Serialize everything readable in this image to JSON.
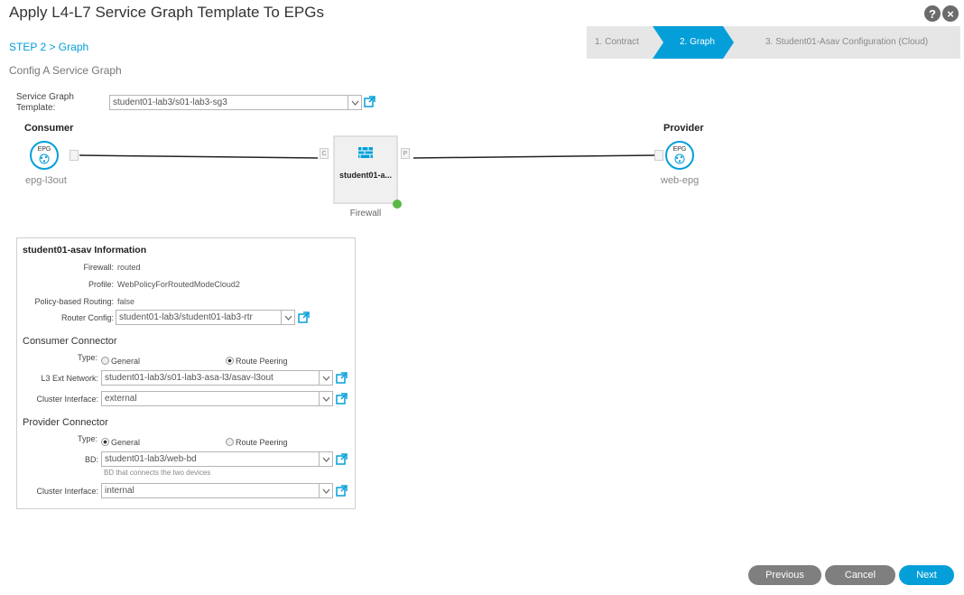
{
  "window": {
    "title": "Apply L4-L7 Service Graph Template To EPGs",
    "help_icon": "?",
    "close_icon": "×"
  },
  "step": {
    "label": "STEP 2 > Graph",
    "subtitle": "Config A Service Graph"
  },
  "wizard": {
    "steps": [
      {
        "label": "1. Contract",
        "active": false
      },
      {
        "label": "2. Graph",
        "active": true
      },
      {
        "label": "3. Student01-Asav Configuration (Cloud)",
        "active": false
      }
    ],
    "active_color": "#049fd9"
  },
  "template": {
    "label": "Service Graph Template:",
    "value": "student01-lab3/s01-lab3-sg3"
  },
  "graph": {
    "consumer": {
      "role": "Consumer",
      "badge": "EPG",
      "name": "epg-l3out"
    },
    "provider": {
      "role": "Provider",
      "badge": "EPG",
      "name": "web-epg"
    },
    "device": {
      "name": "student01-a...",
      "type": "Firewall",
      "status_color": "#5ab847"
    },
    "connectors": {
      "consumer": "C",
      "provider": "P"
    }
  },
  "info": {
    "title": "student01-asav Information",
    "firewall_label": "Firewall:",
    "firewall_value": "routed",
    "profile_label": "Profile:",
    "profile_value": "WebPolicyForRoutedModeCloud2",
    "pbr_label": "Policy-based Routing:",
    "pbr_value": "false",
    "router_label": "Router Config:",
    "router_value": "student01-lab3/student01-lab3-rtr",
    "consumer": {
      "heading": "Consumer Connector",
      "type_label": "Type:",
      "opt_general": "General",
      "opt_route": "Route Peering",
      "selected": "route",
      "l3_label": "L3 Ext Network:",
      "l3_value": "student01-lab3/s01-lab3-asa-l3/asav-l3out",
      "cluster_label": "Cluster Interface:",
      "cluster_value": "external"
    },
    "provider": {
      "heading": "Provider Connector",
      "type_label": "Type:",
      "opt_general": "General",
      "opt_route": "Route Peering",
      "selected": "general",
      "bd_label": "BD:",
      "bd_value": "student01-lab3/web-bd",
      "bd_hint": "BD that connects the two devices",
      "cluster_label": "Cluster Interface:",
      "cluster_value": "internal"
    }
  },
  "buttons": {
    "previous": "Previous",
    "cancel": "Cancel",
    "next": "Next"
  }
}
